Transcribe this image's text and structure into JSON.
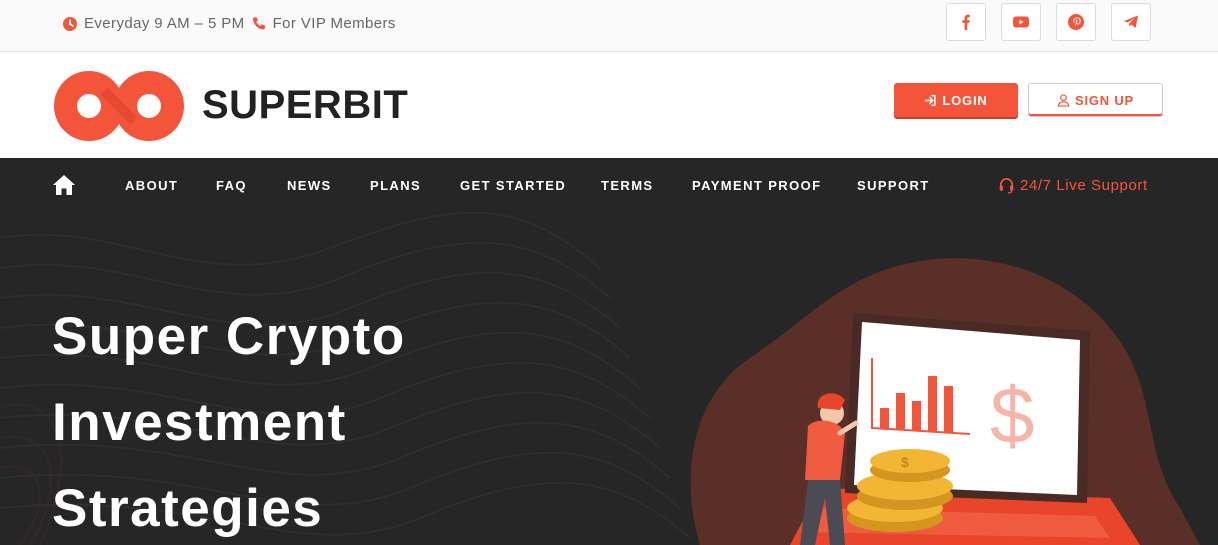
{
  "topbar": {
    "hours": "Everyday 9 AM – 5 PM",
    "members": "For VIP Members",
    "socials": [
      "facebook-icon",
      "youtube-icon",
      "pinterest-icon",
      "telegram-icon"
    ]
  },
  "header": {
    "brand": "SUPERBIT",
    "login_label": "LOGIN",
    "signup_label": "SIGN UP"
  },
  "nav": {
    "items": [
      "ABOUT",
      "FAQ",
      "NEWS",
      "PLANS",
      "GET STARTED",
      "TERMS",
      "PAYMENT PROOF",
      "SUPPORT"
    ],
    "live_support": "24/7 Live Support"
  },
  "hero": {
    "headline_lines": [
      "Super Crypto",
      "Investment",
      "Strategies"
    ]
  },
  "colors": {
    "accent": "#f4553a",
    "dark_bg": "#262627",
    "text_dark": "#222222"
  }
}
